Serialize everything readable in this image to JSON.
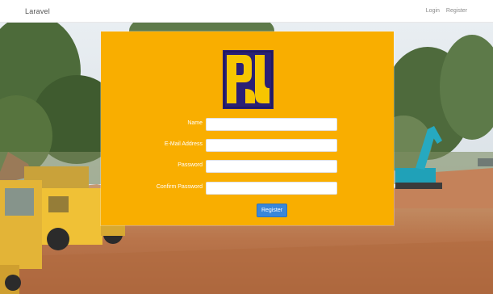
{
  "navbar": {
    "brand": "Laravel",
    "links": [
      "Login",
      "Register"
    ]
  },
  "form": {
    "fields": [
      {
        "label": "Name",
        "value": "",
        "type": "text"
      },
      {
        "label": "E-Mail Address",
        "value": "",
        "type": "email"
      },
      {
        "label": "Password",
        "value": "",
        "type": "password"
      },
      {
        "label": "Confirm Password",
        "value": "",
        "type": "password"
      }
    ],
    "submit_label": "Register"
  },
  "colors": {
    "panel": "#f9ae00",
    "button": "#3a87d9",
    "logo_blue": "#2a2076",
    "logo_yellow": "#f7c600"
  },
  "icons": {
    "logo": "pupr-logo"
  }
}
